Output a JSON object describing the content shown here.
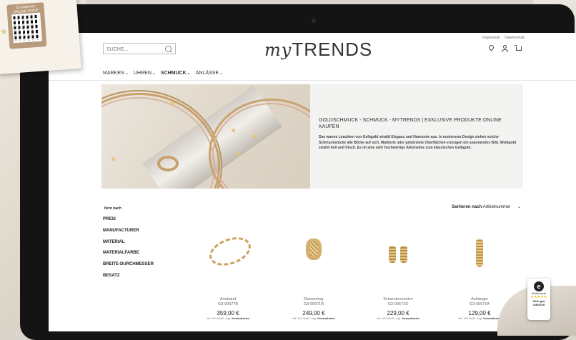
{
  "flyer": {
    "title": "Zu unserem ONLINE-SHOP"
  },
  "header": {
    "search_placeholder": "SUCHE...",
    "logo_script": "my",
    "logo_text": "TRENDS",
    "links": [
      "Impressum",
      "Datenschutz"
    ]
  },
  "nav": [
    {
      "label": "MARKEN",
      "chevron": "⌄"
    },
    {
      "label": "UHREN",
      "chevron": "⌄"
    },
    {
      "label": "SCHMUCK",
      "chevron": "⌄"
    },
    {
      "label": "ANLÄSSE",
      "chevron": "⌄"
    }
  ],
  "nav_active": "SCHMUCK",
  "hero": {
    "title": "GOLDSCHMUCK - SCHMUCK - MYTRENDS | EXKLUSIVE PRODUKTE ONLINE KAUFEN",
    "description": "Das warme Leuchten von Gelbgold strahlt Eleganz und Harmonie aus. In modernem Design ziehen solche Schmuckstücke alle Blicke auf sich. Mattierte oder gebürstete Oberflächen erzeugen ein spannendes Bild. Weißgold strahlt hell und frisch. Es ist eine sehr hochwertige Alternative zum klassischen Gelbgold."
  },
  "filters": {
    "title": "ltern nach",
    "items": [
      "PREIS",
      "MANUFACTURER",
      "MATERIAL",
      "MATERIALFARBE",
      "BREITE-DURCHMESSER",
      "BESATZ"
    ]
  },
  "sort": {
    "label": "Sortieren nach",
    "value": "Artikelnummer",
    "chevron": "⌄"
  },
  "products": [
    {
      "name": "Armband",
      "code": "G3-00677B",
      "price": "359,00 €",
      "note_prefix": "inkl. 19% MwSt., zzgl.",
      "note_link": "Versandkosten"
    },
    {
      "name": "Damenring",
      "code": "G3-00671R",
      "price": "249,00 €",
      "note_prefix": "inkl. 19% MwSt., zzgl.",
      "note_link": "Versandkosten"
    },
    {
      "name": "Scharniercreolen",
      "code": "G3-00671O",
      "price": "229,00 €",
      "note_prefix": "inkl. 19% MwSt., zzgl.",
      "note_link": "Versandkosten"
    },
    {
      "name": "Anhänger",
      "code": "G3-00671A",
      "price": "129,00 €",
      "note_prefix": "inkl. 19% MwSt., zzgl.",
      "note_link": "Versandkosten"
    }
  ],
  "badge": {
    "logo": "e",
    "title": "Käuferschutz",
    "stars": "★★★★★",
    "grade": "Sehr gut",
    "score": "4.80/5.00"
  },
  "colors": {
    "gold": "#caa45f",
    "frame": "#141414",
    "accent_stroke": "#a78b74"
  }
}
